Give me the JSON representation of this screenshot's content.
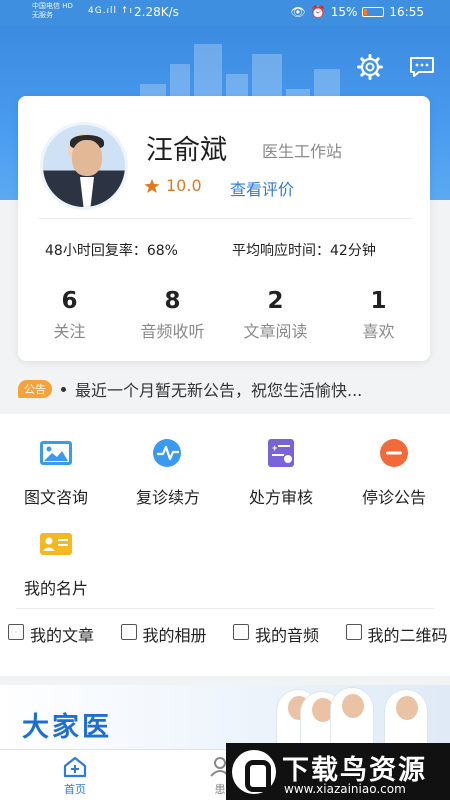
{
  "status_bar": {
    "carrier": "中国电信 HD",
    "carrier_sub": "无服务",
    "signal_text": "4G.ıll ↑ı",
    "speed": "2.28K/s",
    "battery": "15%",
    "battery_level": 0.15,
    "time": "16:55"
  },
  "doctor": {
    "name": "汪俞斌",
    "station": "医生工作站",
    "rating": "10.0",
    "review_link": "查看评价",
    "reply_rate": "48小时回复率：68%",
    "avg_response": "平均响应时间：42分钟"
  },
  "counts": [
    {
      "num": "6",
      "label": "关注"
    },
    {
      "num": "8",
      "label": "音频收听"
    },
    {
      "num": "2",
      "label": "文章阅读"
    },
    {
      "num": "1",
      "label": "喜欢"
    }
  ],
  "notice": {
    "tag": "公告",
    "text": "最近一个月暂无新公告，祝您生活愉快..."
  },
  "features": [
    {
      "label": "图文咨询",
      "icon": "image-icon",
      "color": "#3a9af0"
    },
    {
      "label": "复诊续方",
      "icon": "pulse-icon",
      "color": "#3a9af0"
    },
    {
      "label": "处方审核",
      "icon": "prescription-icon",
      "color": "#7a63d6"
    },
    {
      "label": "停诊公告",
      "icon": "stop-icon",
      "color": "#f06a3a"
    },
    {
      "label": "我的名片",
      "icon": "card-icon",
      "color": "#f5b81f"
    }
  ],
  "sublinks": [
    {
      "label": "我的文章",
      "icon": "article-icon"
    },
    {
      "label": "我的相册",
      "icon": "album-icon"
    },
    {
      "label": "我的音频",
      "icon": "audio-icon"
    },
    {
      "label": "我的二维码",
      "icon": "qrcode-icon"
    }
  ],
  "banner": {
    "title": "大家医"
  },
  "bottom_nav": [
    {
      "label": "首页",
      "icon": "home-icon",
      "active": true
    },
    {
      "label": "患",
      "icon": "patients-icon",
      "active": false
    }
  ],
  "watermark": {
    "title": "下载鸟资源",
    "url": "www.xiazainiao.com"
  },
  "colors": {
    "primary": "#3b8be0",
    "accent": "#2e7bd8",
    "star": "#e07a1f",
    "notice_tag": "#f6a23a"
  }
}
